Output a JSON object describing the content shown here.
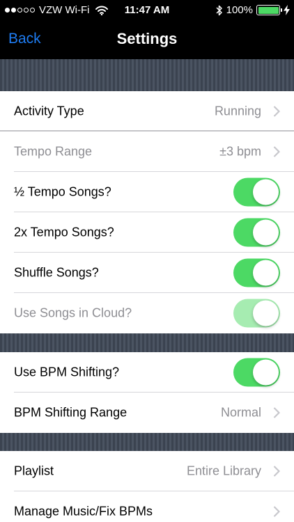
{
  "status_bar": {
    "carrier": "VZW Wi-Fi",
    "time": "11:47 AM",
    "battery_percent": "100%",
    "signal_bars_filled": 2,
    "signal_bars_total": 5
  },
  "nav": {
    "back_label": "Back",
    "title": "Settings"
  },
  "settings": {
    "activity_type": {
      "label": "Activity Type",
      "value": "Running"
    },
    "tempo_range": {
      "label": "Tempo Range",
      "value": "±3 bpm",
      "disabled": true
    },
    "half_tempo": {
      "label": "½ Tempo Songs?",
      "on": true
    },
    "double_tempo": {
      "label": "2x Tempo Songs?",
      "on": true
    },
    "shuffle": {
      "label": "Shuffle Songs?",
      "on": true
    },
    "cloud": {
      "label": "Use Songs in Cloud?",
      "on": true,
      "disabled": true
    },
    "bpm_shifting": {
      "label": "Use BPM Shifting?",
      "on": true
    },
    "bpm_shifting_range": {
      "label": "BPM Shifting Range",
      "value": "Normal"
    },
    "playlist": {
      "label": "Playlist",
      "value": "Entire Library"
    },
    "manage_music": {
      "label": "Manage Music/Fix BPMs"
    }
  },
  "colors": {
    "accent_blue": "#1e7cf2",
    "toggle_green": "#4cd964",
    "secondary_text": "#8e8e93"
  },
  "icons": [
    "wifi-icon",
    "bluetooth-icon",
    "battery-icon",
    "charging-bolt-icon",
    "chevron-right-icon"
  ]
}
